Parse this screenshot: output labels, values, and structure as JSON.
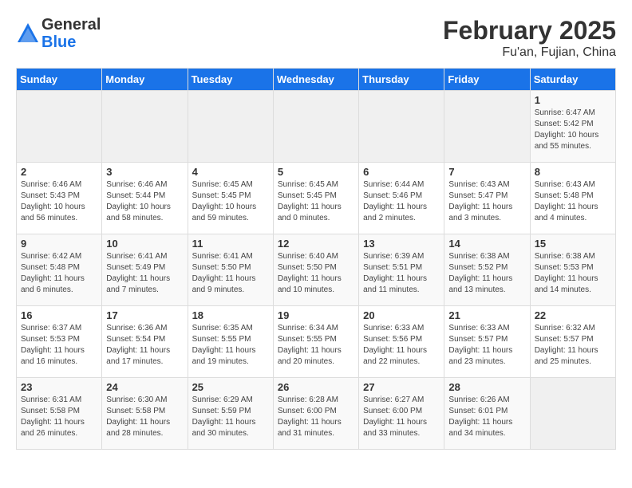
{
  "logo": {
    "general": "General",
    "blue": "Blue"
  },
  "header": {
    "month_year": "February 2025",
    "location": "Fu'an, Fujian, China"
  },
  "days_of_week": [
    "Sunday",
    "Monday",
    "Tuesday",
    "Wednesday",
    "Thursday",
    "Friday",
    "Saturday"
  ],
  "weeks": [
    [
      {
        "day": "",
        "info": ""
      },
      {
        "day": "",
        "info": ""
      },
      {
        "day": "",
        "info": ""
      },
      {
        "day": "",
        "info": ""
      },
      {
        "day": "",
        "info": ""
      },
      {
        "day": "",
        "info": ""
      },
      {
        "day": "1",
        "info": "Sunrise: 6:47 AM\nSunset: 5:42 PM\nDaylight: 10 hours\nand 55 minutes."
      }
    ],
    [
      {
        "day": "2",
        "info": "Sunrise: 6:46 AM\nSunset: 5:43 PM\nDaylight: 10 hours\nand 56 minutes."
      },
      {
        "day": "3",
        "info": "Sunrise: 6:46 AM\nSunset: 5:44 PM\nDaylight: 10 hours\nand 58 minutes."
      },
      {
        "day": "4",
        "info": "Sunrise: 6:45 AM\nSunset: 5:45 PM\nDaylight: 10 hours\nand 59 minutes."
      },
      {
        "day": "5",
        "info": "Sunrise: 6:45 AM\nSunset: 5:45 PM\nDaylight: 11 hours\nand 0 minutes."
      },
      {
        "day": "6",
        "info": "Sunrise: 6:44 AM\nSunset: 5:46 PM\nDaylight: 11 hours\nand 2 minutes."
      },
      {
        "day": "7",
        "info": "Sunrise: 6:43 AM\nSunset: 5:47 PM\nDaylight: 11 hours\nand 3 minutes."
      },
      {
        "day": "8",
        "info": "Sunrise: 6:43 AM\nSunset: 5:48 PM\nDaylight: 11 hours\nand 4 minutes."
      }
    ],
    [
      {
        "day": "9",
        "info": "Sunrise: 6:42 AM\nSunset: 5:48 PM\nDaylight: 11 hours\nand 6 minutes."
      },
      {
        "day": "10",
        "info": "Sunrise: 6:41 AM\nSunset: 5:49 PM\nDaylight: 11 hours\nand 7 minutes."
      },
      {
        "day": "11",
        "info": "Sunrise: 6:41 AM\nSunset: 5:50 PM\nDaylight: 11 hours\nand 9 minutes."
      },
      {
        "day": "12",
        "info": "Sunrise: 6:40 AM\nSunset: 5:50 PM\nDaylight: 11 hours\nand 10 minutes."
      },
      {
        "day": "13",
        "info": "Sunrise: 6:39 AM\nSunset: 5:51 PM\nDaylight: 11 hours\nand 11 minutes."
      },
      {
        "day": "14",
        "info": "Sunrise: 6:38 AM\nSunset: 5:52 PM\nDaylight: 11 hours\nand 13 minutes."
      },
      {
        "day": "15",
        "info": "Sunrise: 6:38 AM\nSunset: 5:53 PM\nDaylight: 11 hours\nand 14 minutes."
      }
    ],
    [
      {
        "day": "16",
        "info": "Sunrise: 6:37 AM\nSunset: 5:53 PM\nDaylight: 11 hours\nand 16 minutes."
      },
      {
        "day": "17",
        "info": "Sunrise: 6:36 AM\nSunset: 5:54 PM\nDaylight: 11 hours\nand 17 minutes."
      },
      {
        "day": "18",
        "info": "Sunrise: 6:35 AM\nSunset: 5:55 PM\nDaylight: 11 hours\nand 19 minutes."
      },
      {
        "day": "19",
        "info": "Sunrise: 6:34 AM\nSunset: 5:55 PM\nDaylight: 11 hours\nand 20 minutes."
      },
      {
        "day": "20",
        "info": "Sunrise: 6:33 AM\nSunset: 5:56 PM\nDaylight: 11 hours\nand 22 minutes."
      },
      {
        "day": "21",
        "info": "Sunrise: 6:33 AM\nSunset: 5:57 PM\nDaylight: 11 hours\nand 23 minutes."
      },
      {
        "day": "22",
        "info": "Sunrise: 6:32 AM\nSunset: 5:57 PM\nDaylight: 11 hours\nand 25 minutes."
      }
    ],
    [
      {
        "day": "23",
        "info": "Sunrise: 6:31 AM\nSunset: 5:58 PM\nDaylight: 11 hours\nand 26 minutes."
      },
      {
        "day": "24",
        "info": "Sunrise: 6:30 AM\nSunset: 5:58 PM\nDaylight: 11 hours\nand 28 minutes."
      },
      {
        "day": "25",
        "info": "Sunrise: 6:29 AM\nSunset: 5:59 PM\nDaylight: 11 hours\nand 30 minutes."
      },
      {
        "day": "26",
        "info": "Sunrise: 6:28 AM\nSunset: 6:00 PM\nDaylight: 11 hours\nand 31 minutes."
      },
      {
        "day": "27",
        "info": "Sunrise: 6:27 AM\nSunset: 6:00 PM\nDaylight: 11 hours\nand 33 minutes."
      },
      {
        "day": "28",
        "info": "Sunrise: 6:26 AM\nSunset: 6:01 PM\nDaylight: 11 hours\nand 34 minutes."
      },
      {
        "day": "",
        "info": ""
      }
    ]
  ]
}
